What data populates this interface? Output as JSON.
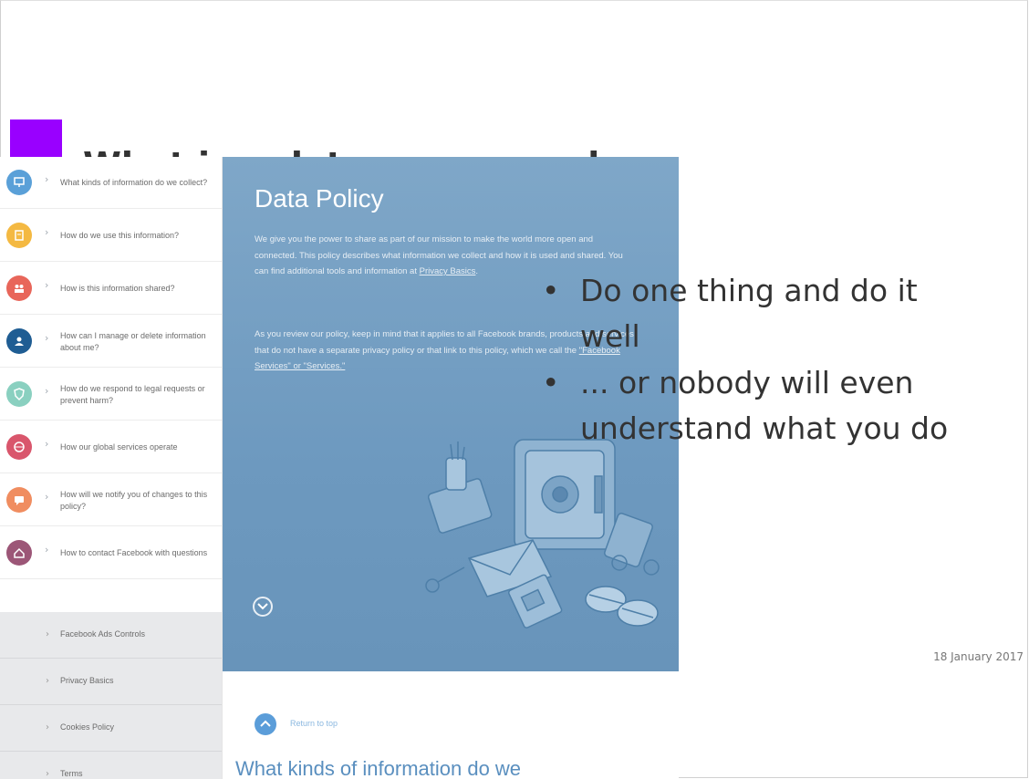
{
  "slide": {
    "title": "What is a data ... approach",
    "bullets": [
      "Do one thing and do it well",
      "... or nobody will even understand what you do"
    ],
    "bullet_symbol": "•",
    "date": "18 January 2017",
    "accent_color": "#9900ff"
  },
  "screenshot": {
    "sidebar_items": [
      {
        "label": "What kinds of information do we collect?",
        "color": "#5aa0d8",
        "icon": "monitor-icon"
      },
      {
        "label": "How do we use this information?",
        "color": "#f4b942",
        "icon": "clipboard-icon"
      },
      {
        "label": "How is this information shared?",
        "color": "#e8665a",
        "icon": "people-icon"
      },
      {
        "label": "How can I manage or delete information about me?",
        "color": "#1f5d93",
        "icon": "user-icon"
      },
      {
        "label": "How do we respond to legal requests or prevent harm?",
        "color": "#8ad0c0",
        "icon": "shield-icon"
      },
      {
        "label": "How our global services operate",
        "color": "#d9566c",
        "icon": "globe-icon"
      },
      {
        "label": "How will we notify you of changes to this policy?",
        "color": "#f08d60",
        "icon": "chat-icon"
      },
      {
        "label": "How to contact Facebook with questions",
        "color": "#9c5677",
        "icon": "home-icon"
      }
    ],
    "footer_links": [
      "Facebook Ads Controls",
      "Privacy Basics",
      "Cookies Policy",
      "Terms"
    ],
    "hero": {
      "title": "Data Policy",
      "para1_a": "We give you the power to share as part of our mission to make the world more open and connected. This policy describes what information we collect and how it is used and shared. You can find additional tools and information at ",
      "para1_link": "Privacy Basics",
      "para1_b": ".",
      "para2_a": "As you review our policy, keep in mind that it applies to all Facebook brands, products and services that do not have a separate privacy policy or that link to this policy, which we call the ",
      "para2_link": "\"Facebook Services\" or \"Services.\""
    },
    "return_label": "Return to top",
    "section_heading": "What kinds of information do we"
  }
}
